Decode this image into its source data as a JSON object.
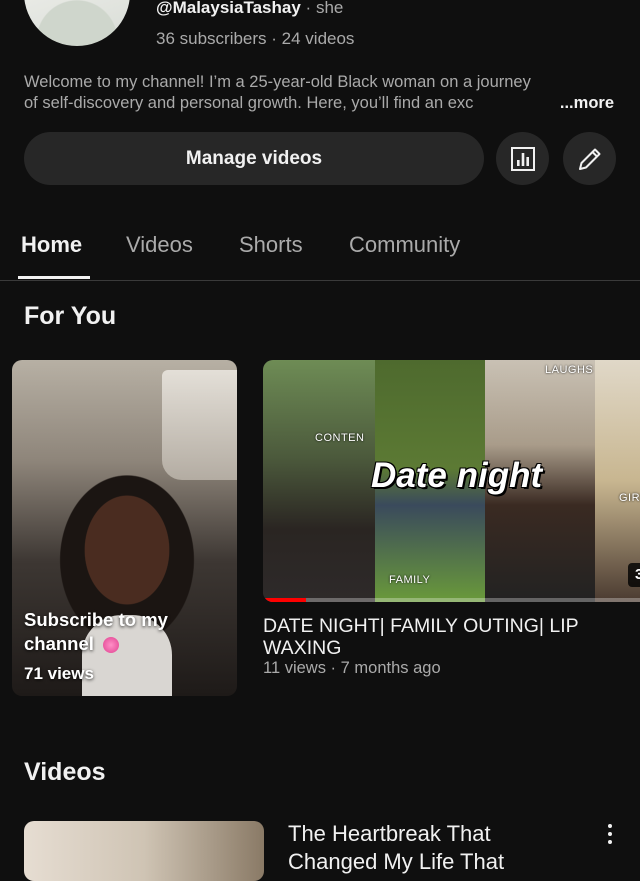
{
  "channel": {
    "handle": "@MalaysiaTashay",
    "pronoun_sep": "·",
    "pronouns": "she",
    "stats": "36 subscribers · 24 videos",
    "description_line1": "Welcome to my channel! I’m a 25-year-old Black woman on a journey",
    "description_line2": "of self-discovery and personal growth. Here, you’ll find an exc",
    "more_label": "...more"
  },
  "actions": {
    "manage_label": "Manage videos",
    "analytics_icon": "analytics-icon",
    "edit_icon": "pencil-icon"
  },
  "tabs": [
    {
      "label": "Home",
      "active": true
    },
    {
      "label": "Videos",
      "active": false
    },
    {
      "label": "Shorts",
      "active": false
    },
    {
      "label": "Community",
      "active": false
    }
  ],
  "for_you": {
    "title": "For You",
    "short": {
      "title": "Subscribe to my channel",
      "emoji": "💗",
      "views": "71 views"
    },
    "video": {
      "thumb_text": "Date night",
      "tags": [
        "CONTEN",
        "LAUGHS",
        "FAMILY",
        "GIRL"
      ],
      "duration": "3",
      "progress_fraction": 0.11,
      "title": "DATE NIGHT| FAMILY OUTING| LIP WAXING",
      "meta": "11 views · 7 months ago"
    }
  },
  "videos_section": {
    "title": "Videos",
    "first_video_title_line1": "The Heartbreak That",
    "first_video_title_line2": "Changed My Life That"
  },
  "colors": {
    "background": "#0f0f0f",
    "chip": "#272727",
    "text_primary": "#f1f1f1",
    "text_secondary": "#aaaaaa",
    "progress": "#ff0000"
  }
}
